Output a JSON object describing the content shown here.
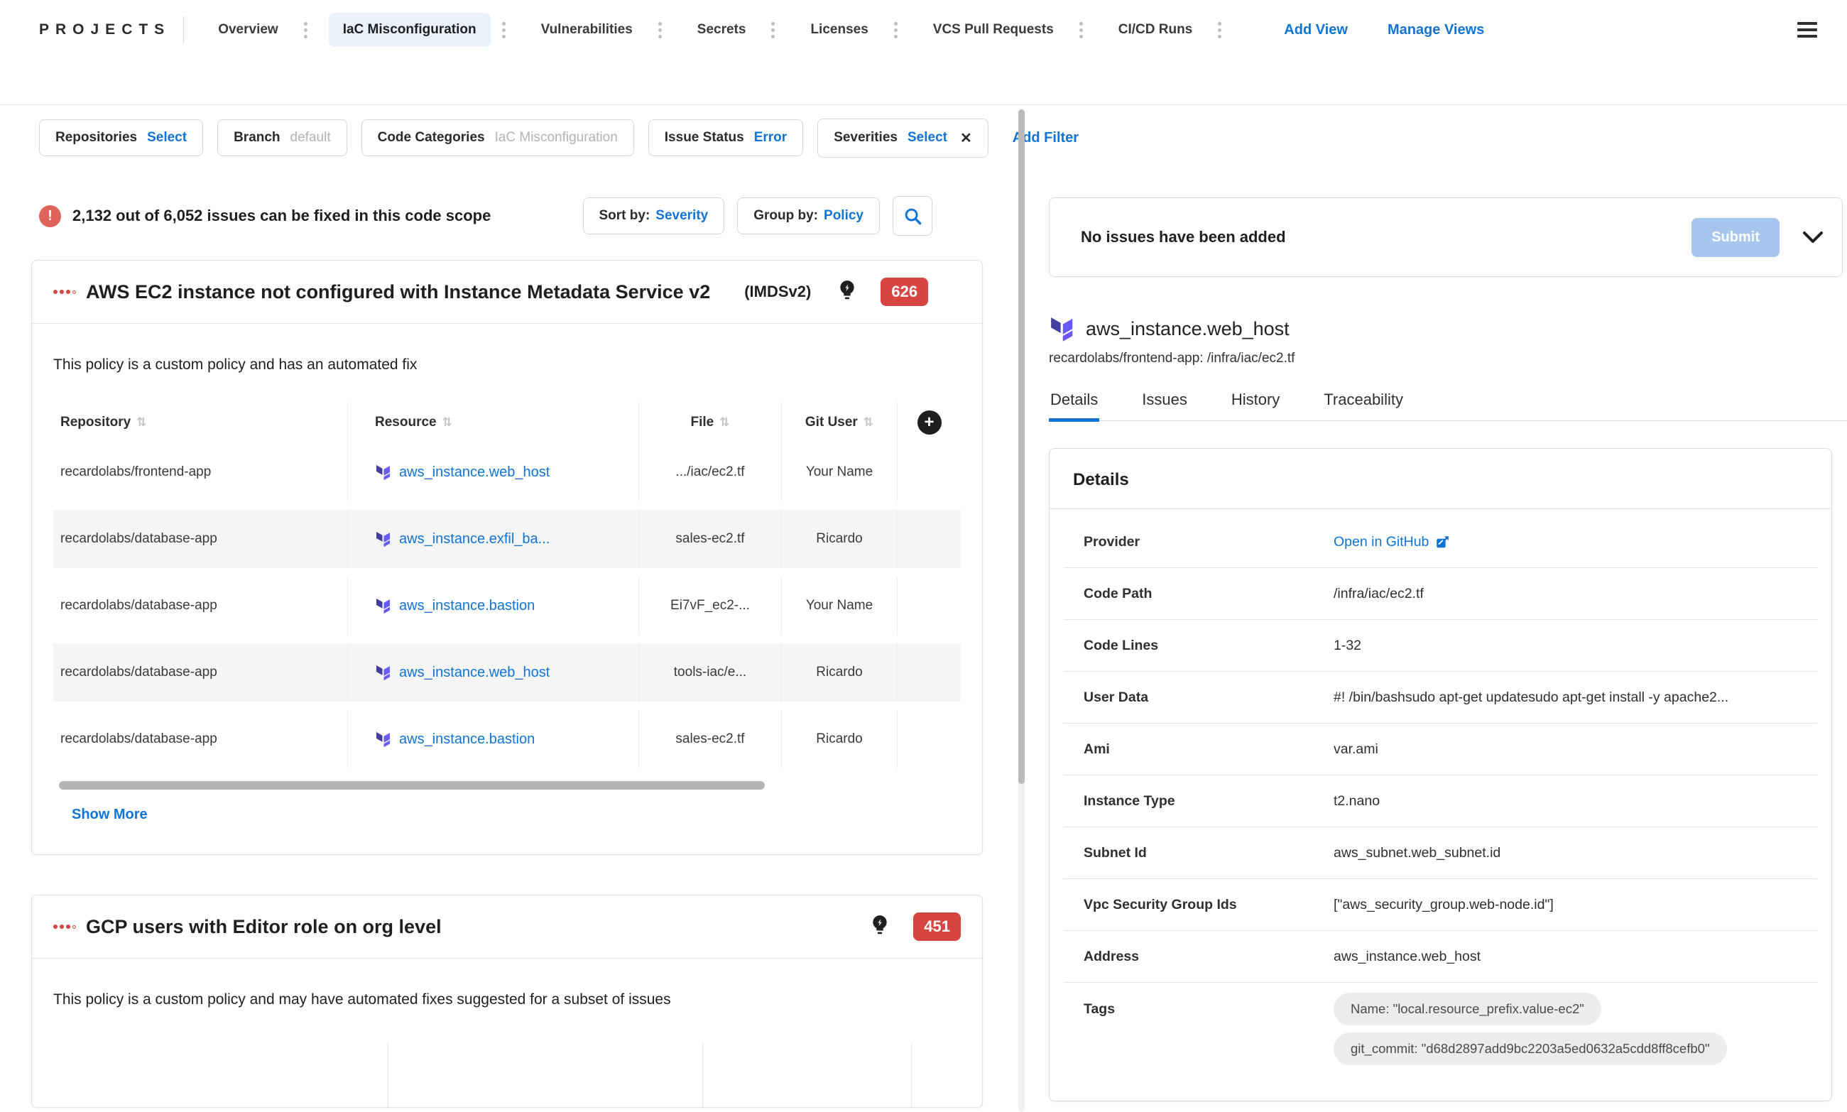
{
  "colors": {
    "accent": "#1173d4",
    "danger": "#d64541",
    "active_tab_bg": "#e9f2fb",
    "terraform_dark": "#403e9e",
    "terraform_light": "#6a5af9"
  },
  "nav": {
    "logo": "PROJECTS",
    "items": [
      {
        "label": "Overview"
      },
      {
        "label": "IaC Misconfiguration"
      },
      {
        "label": "Vulnerabilities"
      },
      {
        "label": "Secrets"
      },
      {
        "label": "Licenses"
      },
      {
        "label": "VCS Pull Requests"
      },
      {
        "label": "CI/CD Runs"
      }
    ],
    "add_view": "Add View",
    "manage_views": "Manage Views"
  },
  "filters": {
    "chips": [
      {
        "label": "Repositories",
        "value": "Select"
      },
      {
        "label": "Branch",
        "value": "default"
      },
      {
        "label": "Code Categories",
        "value": "IaC Misconfiguration"
      },
      {
        "label": "Issue Status",
        "value": "Error"
      },
      {
        "label": "Severities",
        "value": "Select"
      }
    ],
    "add_filter": "Add Filter"
  },
  "left": {
    "summary": "2,132 out of 6,052 issues can be fixed in this code scope",
    "sort_by_label": "Sort by:",
    "sort_by_value": "Severity",
    "group_by_label": "Group by:",
    "group_by_value": "Policy",
    "policies": [
      {
        "title": "AWS EC2 instance not configured with Instance Metadata Service v2",
        "suffix": "(IMDSv2)",
        "count": "626",
        "description": "This policy is a custom policy and has an automated fix",
        "columns": [
          "Repository",
          "Resource",
          "File",
          "Git User"
        ],
        "rows": [
          {
            "repository": "recardolabs/frontend-app",
            "resource": "aws_instance.web_host",
            "file": ".../iac/ec2.tf",
            "git_user": "Your Name"
          },
          {
            "repository": "recardolabs/database-app",
            "resource": "aws_instance.exfil_ba...",
            "file": "sales-ec2.tf",
            "git_user": "Ricardo"
          },
          {
            "repository": "recardolabs/database-app",
            "resource": "aws_instance.bastion",
            "file": "Ei7vF_ec2-...",
            "git_user": "Your Name"
          },
          {
            "repository": "recardolabs/database-app",
            "resource": "aws_instance.web_host",
            "file": "tools-iac/e...",
            "git_user": "Ricardo"
          },
          {
            "repository": "recardolabs/database-app",
            "resource": "aws_instance.bastion",
            "file": "sales-ec2.tf",
            "git_user": "Ricardo"
          }
        ],
        "show_more": "Show More"
      },
      {
        "title": "GCP users with Editor role on org level",
        "count": "451",
        "description": "This policy is a custom policy and may have automated fixes suggested for a subset of issues"
      }
    ]
  },
  "right": {
    "submit_bar": {
      "message": "No issues have been added",
      "submit_label": "Submit"
    },
    "resource": {
      "name": "aws_instance.web_host",
      "path": "recardolabs/frontend-app: /infra/iac/ec2.tf"
    },
    "tabs": [
      {
        "label": "Details"
      },
      {
        "label": "Issues"
      },
      {
        "label": "History"
      },
      {
        "label": "Traceability"
      }
    ],
    "details": {
      "heading": "Details",
      "rows": [
        {
          "label": "Provider",
          "value": "Open in GitHub"
        },
        {
          "label": "Code Path",
          "value": "/infra/iac/ec2.tf"
        },
        {
          "label": "Code Lines",
          "value": "1-32"
        },
        {
          "label": "User Data",
          "value": "#! /bin/bashsudo apt-get updatesudo apt-get install -y apache2..."
        },
        {
          "label": "Ami",
          "value": "var.ami"
        },
        {
          "label": "Instance Type",
          "value": "t2.nano"
        },
        {
          "label": "Subnet Id",
          "value": "aws_subnet.web_subnet.id"
        },
        {
          "label": "Vpc Security Group Ids",
          "value": "[\"aws_security_group.web-node.id\"]"
        },
        {
          "label": "Address",
          "value": "aws_instance.web_host"
        },
        {
          "label": "Tags",
          "tags": [
            "Name: \"local.resource_prefix.value-ec2\"",
            "git_commit: \"d68d2897add9bc2203a5ed0632a5cdd8ff8cefb0\""
          ]
        }
      ]
    }
  }
}
